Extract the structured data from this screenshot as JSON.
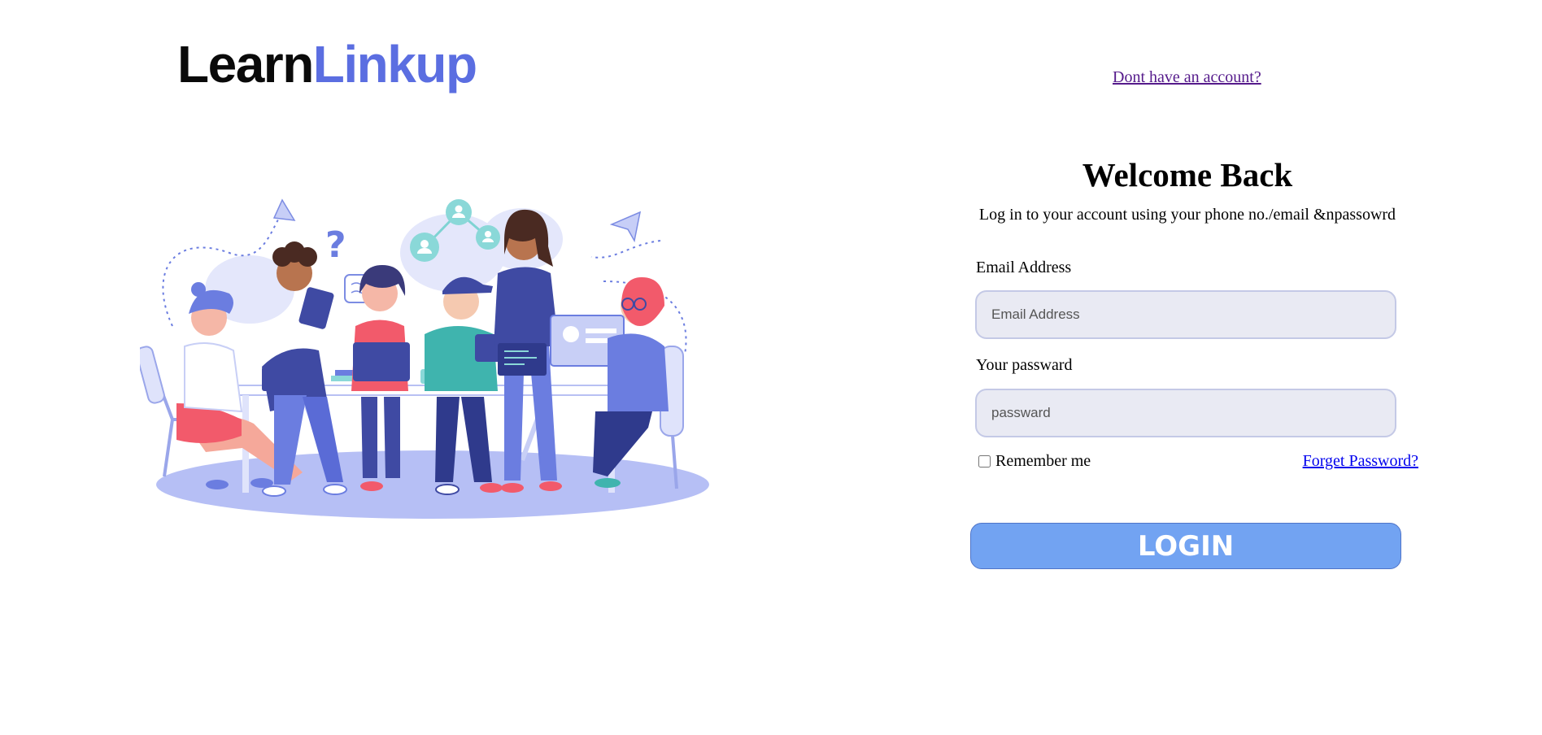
{
  "header": {
    "logo_part1": "Learn",
    "logo_part2": "Linkup",
    "signup_link": "Dont have an account?"
  },
  "form": {
    "title": "Welcome Back",
    "subtitle": "Log in to your account using your phone no./email &npassowrd",
    "email_label": "Email Address",
    "email_placeholder": "Email Address",
    "email_value": "",
    "password_label": "Your passward",
    "password_placeholder": "passward",
    "password_value": "",
    "remember_label": "Remember me",
    "remember_checked": false,
    "forget_link": "Forget Password?",
    "login_button": "LOGIN"
  },
  "colors": {
    "brand_blue": "#5b6ee1",
    "button_blue": "#72a3f2",
    "field_bg": "#e9eaf3",
    "visited_link": "#551a8b",
    "link": "#0000ee"
  },
  "illustration": {
    "icon": "team-working-illustration"
  }
}
